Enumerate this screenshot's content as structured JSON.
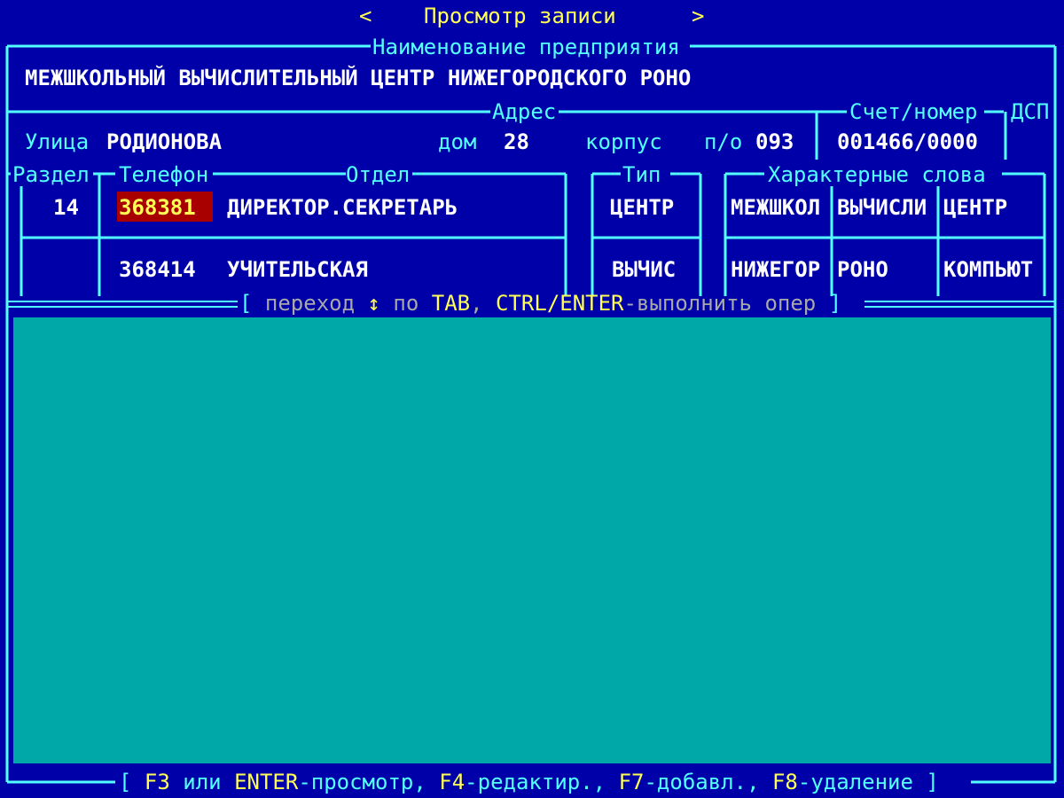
{
  "window": {
    "prev_arrow": "<",
    "title": "Просмотр записи",
    "next_arrow": ">"
  },
  "org": {
    "label": "Наименование предприятия",
    "name": "МЕЖШКОЛЬНЫЙ ВЫЧИСЛИТЕЛЬНЫЙ ЦЕНТР НИЖЕГОРОДСКОГО РОНО"
  },
  "address": {
    "label": "Адрес",
    "street_label": "Улица",
    "street": "РОДИОНОВА",
    "house_label": "дом",
    "house": "28",
    "building_label": "корпус",
    "po_label": "п/о",
    "po": "093"
  },
  "account": {
    "label": "Счет/номер",
    "value": "001466/0000",
    "dsp_label": "ДСП"
  },
  "columns": {
    "section": "Раздел",
    "phone": "Телефон",
    "department": "Отдел",
    "type": "Тип",
    "keywords": "Характерные слова"
  },
  "rows": [
    {
      "section": "14",
      "phone": "368381",
      "department": "ДИРЕКТОР.СЕКРЕТАРЬ",
      "type": "ЦЕНТР",
      "keywords": [
        "МЕЖШКОЛ",
        "ВЫЧИСЛИ",
        "ЦЕНТР"
      ]
    },
    {
      "section": "",
      "phone": "368414",
      "department": "УЧИТЕЛЬСКАЯ",
      "type": "ВЫЧИС",
      "keywords": [
        "НИЖЕГОР",
        "РОНО",
        "КОМПЬЮТ"
      ]
    }
  ],
  "hint": {
    "open": "[",
    "text1": " переход ",
    "arrows": "↕",
    "text2": " по ",
    "key1": "TAB",
    "text3": ", ",
    "key2": "CTRL/ENTER",
    "text4": "-выполнить опер ",
    "close": "]"
  },
  "footer": {
    "open": "[ ",
    "k1": "F3",
    "t1": " или ",
    "k2": "ENTER",
    "t2": "-просмотр, ",
    "k3": "F4",
    "t3": "-редактир., ",
    "k4": "F7",
    "t4": "-добавл., ",
    "k5": "F8",
    "t5": "-удаление ",
    "close": "]"
  },
  "colors": {
    "background": "#0000a8",
    "frame": "#54ffff",
    "title_text": "#ffff54",
    "value_text": "#ffffff",
    "highlight_cell": "#a80000",
    "panel": "#00a8a8",
    "hint_text": "#a8a8a8"
  }
}
